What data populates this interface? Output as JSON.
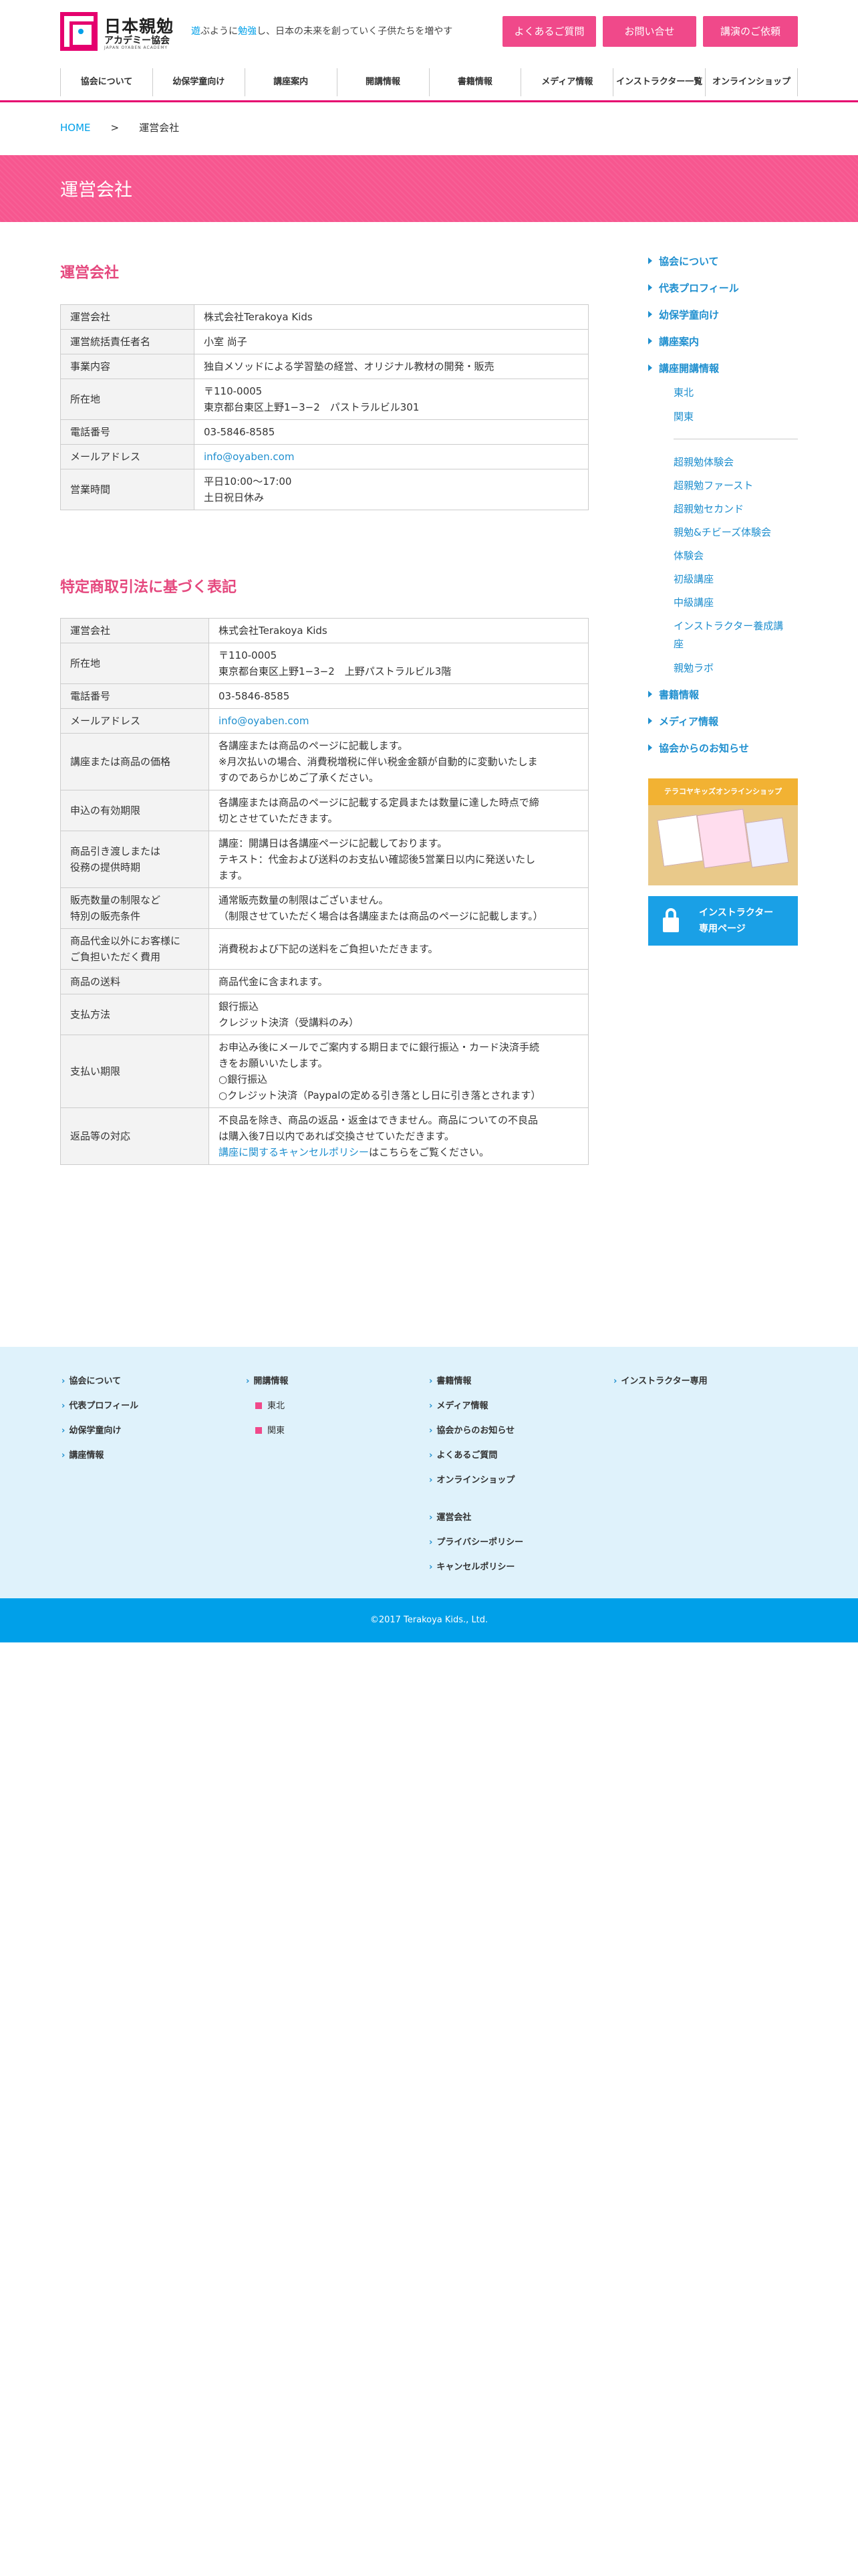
{
  "header": {
    "logo": {
      "title": "日本親勉",
      "subtitle": "アカデミー協会",
      "en": "JAPAN OYABEN ACADEMY"
    },
    "tagline": {
      "p1": "遊",
      "p2": "ぶように",
      "p3": "勉強",
      "p4": "し、日本の未来を創っていく子供たちを増やす"
    },
    "buttons": [
      "よくあるご質問",
      "お問い合せ",
      "講演のご依頼"
    ],
    "nav": [
      "協会について",
      "幼保学童向け",
      "講座案内",
      "開講情報",
      "書籍情報",
      "メディア情報",
      "インストラクター一覧",
      "オンラインショップ"
    ]
  },
  "breadcrumb": {
    "home": "HOME",
    "sep": ">",
    "current": "運営会社"
  },
  "banner_title": "運営会社",
  "section1": {
    "heading": "運営会社",
    "rows": [
      [
        "運営会社",
        "株式会社Terakoya Kids"
      ],
      [
        "運営統括責任者名",
        "小室 尚子"
      ],
      [
        "事業内容",
        "独自メソッドによる学習塾の経営、オリジナル教材の開発・販売"
      ],
      [
        "所在地",
        "〒110-0005",
        "東京都台東区上野1−3−2　パストラルビル301"
      ],
      [
        "電話番号",
        "03-5846-8585"
      ],
      [
        "メールアドレス",
        "info@oyaben.com"
      ],
      [
        "営業時間",
        "平日10:00〜17:00",
        "土日祝日休み"
      ]
    ]
  },
  "section2": {
    "heading": "特定商取引法に基づく表記",
    "rows": [
      {
        "k": [
          "運営会社"
        ],
        "v": [
          "株式会社Terakoya Kids"
        ]
      },
      {
        "k": [
          "所在地"
        ],
        "v": [
          "〒110-0005",
          "東京都台東区上野1−3−2　上野パストラルビル3階"
        ]
      },
      {
        "k": [
          "電話番号"
        ],
        "v": [
          "03-5846-8585"
        ]
      },
      {
        "k": [
          "メールアドレス"
        ],
        "v": [
          "info@oyaben.com"
        ]
      },
      {
        "k": [
          "講座または商品の価格"
        ],
        "v": [
          "各講座または商品のページに記載します。",
          "※月次払いの場合、消費税増税に伴い税金金額が自動的に変動いたしま",
          "すのであらかじめご了承ください。"
        ]
      },
      {
        "k": [
          "申込の有効期限"
        ],
        "v": [
          "各講座または商品のページに記載する定員または数量に達した時点で締",
          "切とさせていただきます。"
        ]
      },
      {
        "k": [
          "商品引き渡しまたは",
          "役務の提供時期"
        ],
        "v": [
          "講座：開講日は各講座ページに記載しております。",
          "テキスト：代金および送料のお支払い確認後5営業日以内に発送いたし",
          "ます。"
        ]
      },
      {
        "k": [
          "販売数量の制限など",
          "特別の販売条件"
        ],
        "v": [
          "通常販売数量の制限はございません。",
          "（制限させていただく場合は各講座または商品のページに記載します。）"
        ]
      },
      {
        "k": [
          "商品代金以外にお客様に",
          "ご負担いただく費用"
        ],
        "v": [
          "消費税および下記の送料をご負担いただきます。"
        ]
      },
      {
        "k": [
          "商品の送料"
        ],
        "v": [
          "商品代金に含まれます。"
        ]
      },
      {
        "k": [
          "支払方法"
        ],
        "v": [
          "銀行振込",
          "クレジット決済（受講料のみ）"
        ]
      },
      {
        "k": [
          "支払い期限"
        ],
        "v": [
          "お申込み後にメールでご案内する期日までに銀行振込・カード決済手続",
          "きをお願いいたします。",
          "○銀行振込",
          "○クレジット決済（Paypalの定める引き落とし日に引き落とされます）"
        ]
      },
      {
        "k": [
          "返品等の対応"
        ],
        "v": [
          "不良品を除き、商品の返品・返金はできません。商品についての不良品",
          "は購入後7日以内であれば交換させていただきます。"
        ],
        "link": "講座に関するキャンセルポリシー",
        "link_after": "はこちらをご覧ください。"
      }
    ]
  },
  "sidebar": {
    "items": [
      "協会について",
      "代表プロフィール",
      "幼保学童向け",
      "講座案内",
      "講座開講情報"
    ],
    "regions": [
      "東北",
      "関東"
    ],
    "courses": [
      "超親勉体験会",
      "超親勉ファースト",
      "超親勉セカンド",
      "親勉&チビーズ体験会",
      "体験会",
      "初級講座",
      "中級講座",
      "インストラクター養成講",
      "座",
      "親勉ラボ"
    ],
    "items2": [
      "書籍情報",
      "メディア情報",
      "協会からのお知らせ"
    ],
    "shop_label": "テラコヤキッズオンラインショップ",
    "instructor": [
      "インストラクター",
      "専用ページ"
    ]
  },
  "footer": {
    "col1": [
      "協会について",
      "代表プロフィール",
      "幼保学童向け",
      "講座情報"
    ],
    "col2_title": "開講情報",
    "col2_subs": [
      "東北",
      "関東"
    ],
    "col3": [
      "書籍情報",
      "メディア情報",
      "協会からのお知らせ",
      "よくあるご質問",
      "オンラインショップ"
    ],
    "col3b": [
      "運営会社",
      "プライバシーポリシー",
      "キャンセルポリシー"
    ],
    "col4": [
      "インストラクター専用"
    ],
    "copyright": "©2017 Terakoya Kids., Ltd."
  },
  "colors": {
    "brand_pink": "#e5006e",
    "banner_pink": "#f7568f",
    "accent_blue": "#00a0e9",
    "link_blue": "#1f8fcf",
    "footer_bg": "#dff2fb"
  }
}
